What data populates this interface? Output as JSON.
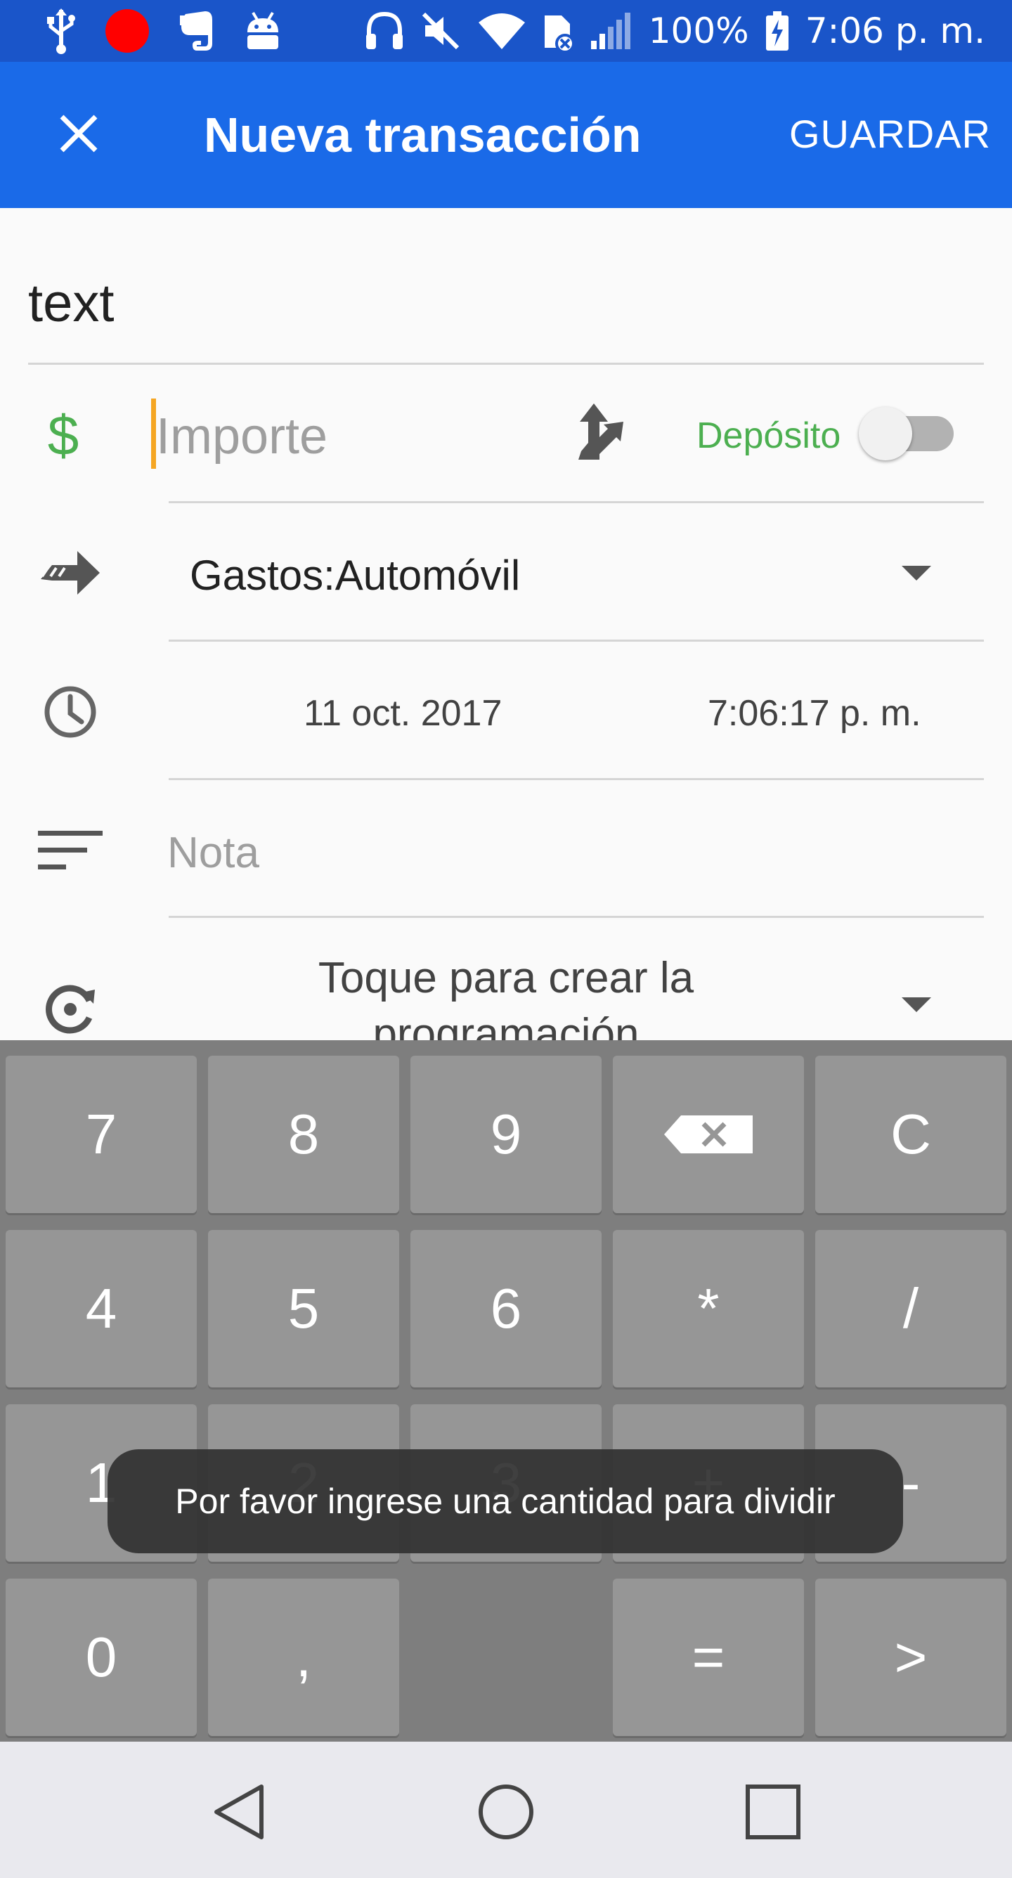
{
  "status_bar": {
    "battery": "100%",
    "time": "7:06 p. m."
  },
  "toolbar": {
    "title": "Nueva transacción",
    "save_label": "GUARDAR"
  },
  "form": {
    "description": "text",
    "currency_symbol": "$",
    "amount_placeholder": "Importe",
    "deposit_label": "Depósito",
    "deposit_enabled": false,
    "account": "Gastos:Automóvil",
    "date": "11 oct. 2017",
    "time": "7:06:17 p. m.",
    "note_placeholder": "Nota",
    "schedule_text": "Toque para crear la programación"
  },
  "keypad": {
    "rows": [
      [
        "7",
        "8",
        "9",
        "backspace-icon",
        "C"
      ],
      [
        "4",
        "5",
        "6",
        "*",
        "/"
      ],
      [
        "1",
        "2",
        "3",
        "+",
        "-"
      ],
      [
        "0",
        ",",
        "",
        "=",
        ">"
      ]
    ],
    "k7": "7",
    "k8": "8",
    "k9": "9",
    "clear": "C",
    "k4": "4",
    "k5": "5",
    "k6": "6",
    "multiply": "*",
    "divide": "/",
    "k1": "1",
    "k2": "2",
    "k3": "3",
    "plus": "+",
    "minus": "-",
    "k0": "0",
    "comma": ",",
    "equals": "=",
    "next": ">"
  },
  "toast": {
    "message": "Por favor ingrese una cantidad para dividir"
  },
  "colors": {
    "status_bar": "#1a55c9",
    "toolbar": "#1a6ae8",
    "accent_green": "#4caf50",
    "cursor": "#f5a623",
    "keypad_bg": "#7e7e7e",
    "key_bg": "#969696"
  }
}
